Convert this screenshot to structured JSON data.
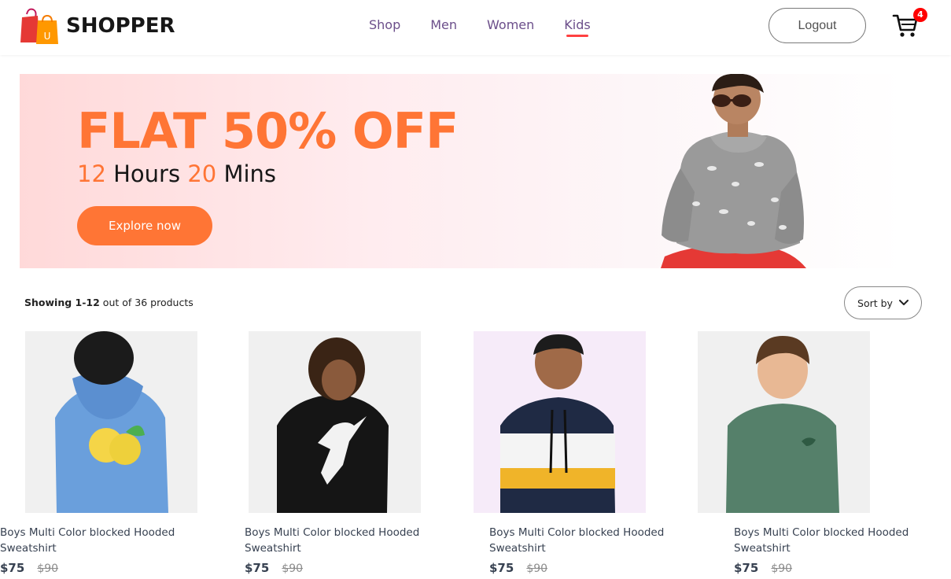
{
  "brand": {
    "name": "SHOPPER",
    "logo_letter": "U",
    "accent": "#ff4141"
  },
  "nav": {
    "items": [
      {
        "label": "Shop"
      },
      {
        "label": "Men"
      },
      {
        "label": "Women"
      },
      {
        "label": "Kids",
        "active": true
      }
    ],
    "logout_label": "Logout",
    "cart_count": "4"
  },
  "banner": {
    "title": "FLAT 50% OFF",
    "hours": "12",
    "hours_label": "Hours",
    "mins": "20",
    "mins_label": "Mins",
    "cta_label": "Explore now",
    "accent": "#ff7535"
  },
  "index": {
    "showing_range": "Showing 1-12",
    "total_text": "out of 36 products",
    "sort_label": "Sort by"
  },
  "products": [
    {
      "name": "Boys Multi Color blocked Hooded Sweatshirt",
      "new_price": "$75",
      "old_price": "$90",
      "hoodie_color": "#6a9fdc"
    },
    {
      "name": "Boys Multi Color blocked Hooded Sweatshirt",
      "new_price": "$75",
      "old_price": "$90",
      "hoodie_color": "#151515"
    },
    {
      "name": "Boys Multi Color blocked Hooded Sweatshirt",
      "new_price": "$75",
      "old_price": "$90",
      "hoodie_color": "#1f2a44"
    },
    {
      "name": "Boys Multi Color blocked Hooded Sweatshirt",
      "new_price": "$75",
      "old_price": "$90",
      "hoodie_color": "#55806a"
    }
  ]
}
